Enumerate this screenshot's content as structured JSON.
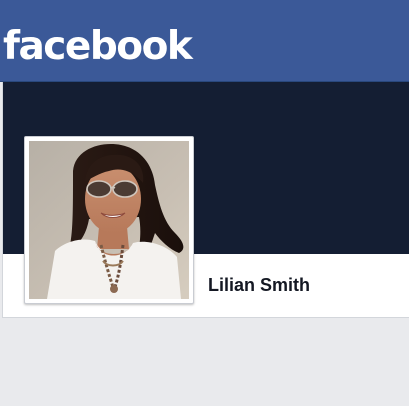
{
  "header": {
    "logo_text": "facebook",
    "brand_color": "#3b5998"
  },
  "profile": {
    "name": "Lilian Smith",
    "cover_color": "#141e33",
    "photo_icon": "profile-photo"
  }
}
